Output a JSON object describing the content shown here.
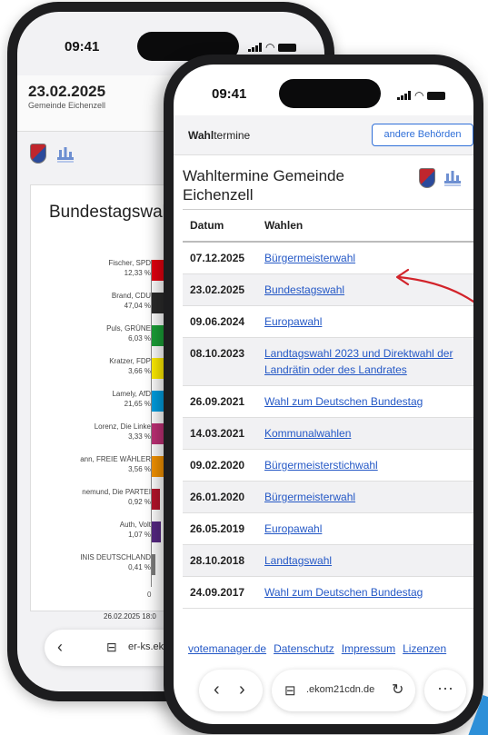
{
  "back_phone": {
    "time": "09:41",
    "date": "23.02.2025",
    "municipality": "Gemeinde Eichenzell",
    "title": "Bundestagswahl Eichenzell (Erststi",
    "chart_data": {
      "type": "bar",
      "orientation": "horizontal",
      "categories": [
        "Fischer, SPD",
        "Brand, CDU",
        "Puls, GRÜNE",
        "Kratzer, FDP",
        "Lamely, AfD",
        "Lorenz, Die Linke",
        "ann, FREIE WÄHLER",
        "nemund, Die PARTEI",
        "Auth, Volt",
        "INIS DEUTSCHLAND"
      ],
      "value_labels": [
        "12,33 %",
        "47,04 %",
        "6,03 %",
        "3,66 %",
        "21,65 %",
        "3,33 %",
        "3,56 %",
        "0,92 %",
        "1,07 %",
        "0,41 %"
      ],
      "values": [
        12.33,
        47.04,
        6.03,
        3.66,
        21.65,
        3.33,
        3.56,
        0.92,
        1.07,
        0.41
      ],
      "colors": [
        "#e3000f",
        "#2b2b2b",
        "#1aa037",
        "#ffed00",
        "#009ee0",
        "#be3075",
        "#f39200",
        "#b5152b",
        "#562883",
        "#7a7a7a"
      ],
      "axis_zero_label": "0"
    },
    "footer_timestamp": "26.02.2025 18:0",
    "url": "er-ks.eko"
  },
  "front_phone": {
    "time": "09:41",
    "site_name_bold": "Wahl",
    "site_name_rest": "termine",
    "other_button": "andere Behörden",
    "page_title": "Wahltermine Gemeinde Eichenzell",
    "table": {
      "headers": {
        "date": "Datum",
        "elections": "Wahlen"
      },
      "rows": [
        {
          "date": "07.12.2025",
          "election": "Bürgermeisterwahl"
        },
        {
          "date": "23.02.2025",
          "election": "Bundestagswahl"
        },
        {
          "date": "09.06.2024",
          "election": "Europawahl"
        },
        {
          "date": "08.10.2023",
          "election": "Landtagswahl 2023 und Direktwahl der Landrätin oder des Landrates"
        },
        {
          "date": "26.09.2021",
          "election": "Wahl zum Deutschen Bundestag"
        },
        {
          "date": "14.03.2021",
          "election": "Kommunalwahlen"
        },
        {
          "date": "09.02.2020",
          "election": "Bürgermeisterstichwahl"
        },
        {
          "date": "26.01.2020",
          "election": "Bürgermeisterwahl"
        },
        {
          "date": "26.05.2019",
          "election": "Europawahl"
        },
        {
          "date": "28.10.2018",
          "election": "Landtagswahl"
        },
        {
          "date": "24.09.2017",
          "election": "Wahl zum Deutschen Bundestag"
        }
      ]
    },
    "footer_links": [
      "votemanager.de",
      "Datenschutz",
      "Impressum",
      "Lizenzen"
    ],
    "url": ".ekom21cdn.de",
    "nav": {
      "back": "‹",
      "forward": "›",
      "more": "···",
      "reload": "↻",
      "tabs": "⊟"
    },
    "annotation_color": "#d2232a"
  }
}
